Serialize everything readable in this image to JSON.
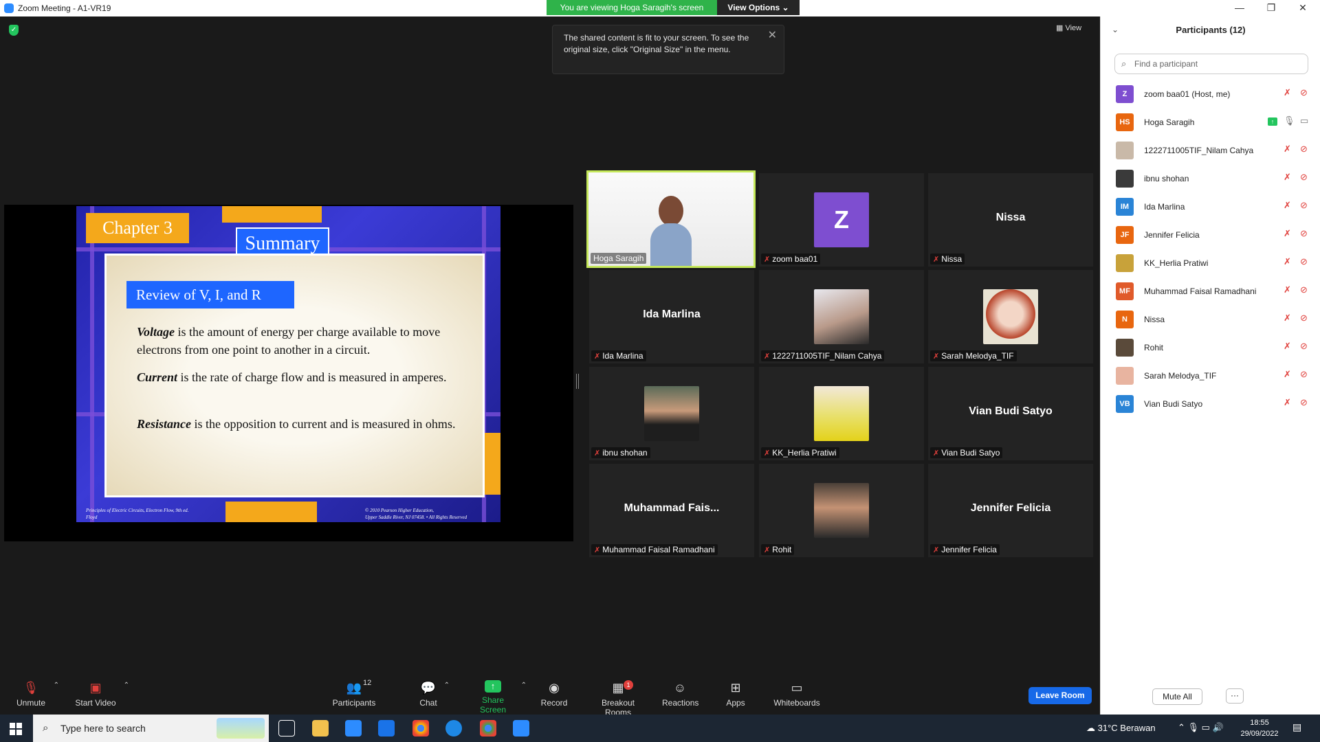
{
  "window": {
    "title": "Zoom Meeting - A1-VR19",
    "minimize": "—",
    "restore": "❐",
    "close": "✕"
  },
  "banner": {
    "viewing": "You are viewing Hoga Saragih's screen",
    "view_options": "View Options ⌄"
  },
  "topbar": {
    "view_label": "View"
  },
  "tooltip": {
    "text": "The shared content is fit to your screen. To see the original size, click \"Original Size\" in the menu."
  },
  "slide": {
    "chapter": "Chapter 3",
    "summary": "Summary",
    "review": "Review of V, I, and R",
    "voltage_term": "Voltage",
    "voltage_text": " is  the amount of energy per charge available to move electrons from one point to another in a circuit.",
    "current_term": "Current",
    "current_text": " is the rate of charge flow and is measured in amperes.",
    "resistance_term": "Resistance",
    "resistance_text": " is the opposition to current and is measured in ohms.",
    "footer_left_1": "Principles of Electric Circuits, Electron Flow,  9th ed.",
    "footer_left_2": "Floyd",
    "footer_right_1": "© 2010 Pearson Higher Education,",
    "footer_right_2": "Upper Saddle River, NJ 07458. • All Rights Reserved"
  },
  "gallery": [
    {
      "name": "Hoga Saragih",
      "type": "video"
    },
    {
      "name": "zoom baa01",
      "type": "letter",
      "letter": "Z"
    },
    {
      "name": "Nissa",
      "type": "name",
      "center": "Nissa"
    },
    {
      "name": "Ida Marlina",
      "type": "name",
      "center": "Ida Marlina"
    },
    {
      "name": "1222711005TIF_Nilam Cahya",
      "type": "photo"
    },
    {
      "name": "Sarah Melodya_TIF",
      "type": "photo"
    },
    {
      "name": "ibnu shohan",
      "type": "photo"
    },
    {
      "name": "KK_Herlia Pratiwi",
      "type": "photo"
    },
    {
      "name": "Vian Budi Satyo",
      "type": "name",
      "center": "Vian Budi Satyo"
    },
    {
      "name": "Muhammad Faisal Ramadhani",
      "type": "name",
      "center": "Muhammad  Fais..."
    },
    {
      "name": "Rohit",
      "type": "photo"
    },
    {
      "name": "Jennifer Felicia",
      "type": "name",
      "center": "Jennifer Felicia"
    }
  ],
  "toolbar": {
    "unmute": "Unmute",
    "start_video": "Start Video",
    "participants": "Participants",
    "participants_count": "12",
    "chat": "Chat",
    "share_screen": "Share Screen",
    "record": "Record",
    "breakout": "Breakout Rooms",
    "breakout_badge": "1",
    "reactions": "Reactions",
    "apps": "Apps",
    "whiteboards": "Whiteboards",
    "leave": "Leave Room"
  },
  "participants_panel": {
    "title": "Participants (12)",
    "search_placeholder": "Find a participant",
    "list": [
      {
        "initials": "Z",
        "name": "zoom baa01 (Host, me)",
        "color": "#7e4ed0"
      },
      {
        "initials": "HS",
        "name": "Hoga Saragih",
        "color": "#e8660f",
        "sharing": true
      },
      {
        "initials": "",
        "name": "1222711005TIF_Nilam Cahya",
        "color": "#c9b9a8"
      },
      {
        "initials": "",
        "name": "ibnu shohan",
        "color": "#3a3a3a"
      },
      {
        "initials": "IM",
        "name": "Ida Marlina",
        "color": "#2a84d6"
      },
      {
        "initials": "JF",
        "name": "Jennifer Felicia",
        "color": "#e8660f"
      },
      {
        "initials": "",
        "name": "KK_Herlia Pratiwi",
        "color": "#c8a23a"
      },
      {
        "initials": "MF",
        "name": "Muhammad Faisal Ramadhani",
        "color": "#e05a2a"
      },
      {
        "initials": "N",
        "name": "Nissa",
        "color": "#e8660f"
      },
      {
        "initials": "",
        "name": "Rohit",
        "color": "#5a4a3a"
      },
      {
        "initials": "",
        "name": "Sarah Melodya_TIF",
        "color": "#e8b4a0"
      },
      {
        "initials": "VB",
        "name": "Vian Budi Satyo",
        "color": "#2a84d6"
      }
    ],
    "mute_all": "Mute All",
    "more": "···"
  },
  "taskbar": {
    "search_placeholder": "Type here to search",
    "weather": "31°C  Berawan",
    "time": "18:55",
    "date": "29/09/2022"
  }
}
